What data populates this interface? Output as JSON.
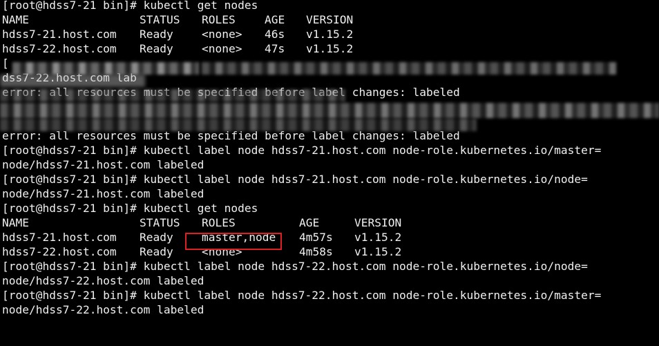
{
  "terminal": {
    "lines": [
      {
        "type": "prompt",
        "text": "[root@hdss7-21 bin]# kubectl get nodes"
      },
      {
        "type": "header1",
        "cols": [
          "NAME",
          "STATUS",
          "ROLES",
          "AGE",
          "VERSION"
        ]
      },
      {
        "type": "row1",
        "cols": [
          "hdss7-21.host.com",
          "Ready",
          "<none>",
          "46s",
          "v1.15.2"
        ]
      },
      {
        "type": "row1",
        "cols": [
          "hdss7-22.host.com",
          "Ready",
          "<none>",
          "47s",
          "v1.15.2"
        ]
      },
      {
        "type": "redacted",
        "text": "[ "
      },
      {
        "type": "redacted",
        "text": "dss7-22.host.com lab"
      },
      {
        "type": "redacted",
        "text": "error: all resources must be specified before label changes: labeled"
      },
      {
        "type": "redacted",
        "text": ""
      },
      {
        "type": "redacted",
        "text": ""
      },
      {
        "type": "text",
        "text": "error: all resources must be specified before label changes: labeled"
      },
      {
        "type": "prompt",
        "text": "[root@hdss7-21 bin]# kubectl label node hdss7-21.host.com node-role.kubernetes.io/master="
      },
      {
        "type": "text",
        "text": "node/hdss7-21.host.com labeled"
      },
      {
        "type": "prompt",
        "text": "[root@hdss7-21 bin]# kubectl label node hdss7-21.host.com node-role.kubernetes.io/node="
      },
      {
        "type": "text",
        "text": "node/hdss7-21.host.com labeled"
      },
      {
        "type": "prompt",
        "text": "[root@hdss7-21 bin]# kubectl get nodes"
      },
      {
        "type": "header2",
        "cols": [
          "NAME",
          "STATUS",
          "ROLES",
          "AGE",
          "VERSION"
        ]
      },
      {
        "type": "row2",
        "cols": [
          "hdss7-21.host.com",
          "Ready",
          "master,node",
          "4m57s",
          "v1.15.2"
        ]
      },
      {
        "type": "row2",
        "cols": [
          "hdss7-22.host.com",
          "Ready",
          "<none>",
          "4m58s",
          "v1.15.2"
        ]
      },
      {
        "type": "prompt",
        "text": "[root@hdss7-21 bin]# kubectl label node hdss7-22.host.com node-role.kubernetes.io/node="
      },
      {
        "type": "text",
        "text": "node/hdss7-22.host.com labeled"
      },
      {
        "type": "prompt",
        "text": "[root@hdss7-21 bin]# kubectl label node hdss7-22.host.com node-role.kubernetes.io/master="
      },
      {
        "type": "text",
        "text": "node/hdss7-22.host.com labeled"
      }
    ],
    "highlight": {
      "color": "#e02020",
      "text": "master,node"
    }
  },
  "colors": {
    "background": "#000000",
    "foreground": "#f0f0f0",
    "highlight_border": "#e02020"
  }
}
